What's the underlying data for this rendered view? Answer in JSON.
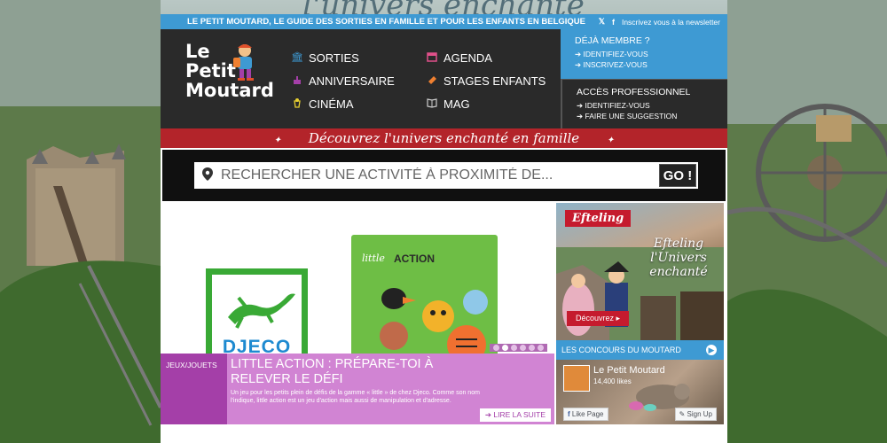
{
  "background": {
    "title": "l'univers enchanté"
  },
  "topbar": {
    "tagline": "LE PETIT MOUTARD, LE GUIDE DES SORTIES EN FAMILLE ET POUR LES ENFANTS EN BELGIQUE",
    "twitter_icon": "twitter-icon",
    "facebook_icon": "facebook-icon",
    "newsletter": "Inscrivez vous à la newsletter"
  },
  "logo": {
    "line1": "Le",
    "line2": "Petit",
    "line3": "Moutard"
  },
  "nav": {
    "items": [
      {
        "label": "SORTIES",
        "icon": "museum-icon",
        "color": "#3e9ad3"
      },
      {
        "label": "AGENDA",
        "icon": "calendar-icon",
        "color": "#e0508a"
      },
      {
        "label": "ANNIVERSAIRE",
        "icon": "cake-icon",
        "color": "#a43fa8"
      },
      {
        "label": "STAGES ENFANTS",
        "icon": "ticket-icon",
        "color": "#f08030"
      },
      {
        "label": "CINÉMA",
        "icon": "popcorn-icon",
        "color": "#e8d030"
      },
      {
        "label": "MAG",
        "icon": "book-icon",
        "color": "#cccccc"
      }
    ]
  },
  "member": {
    "heading": "DÉJÀ MEMBRE ?",
    "login": "IDENTIFIEZ-VOUS",
    "register": "INSCRIVEZ-VOUS"
  },
  "pro": {
    "heading": "ACCÈS PROFESSIONNEL",
    "login": "IDENTIFIEZ-VOUS",
    "suggest": "FAIRE UNE SUGGESTION"
  },
  "banner": {
    "text": "Découvrez l'univers enchanté en famille"
  },
  "search": {
    "placeholder": "RECHERCHER UNE ACTIVITÉ À PROXIMITÉ DE...",
    "go": "GO !"
  },
  "feature": {
    "djeco": "DJECO",
    "box_title": "ACTION",
    "box_script": "little",
    "tag": "JEUX/JOUETS",
    "title": "LITTLE ACTION : PRÉPARE-TOI À RELEVER LE DÉFI",
    "text": "Un jeu pour les petits plein de défis de la gamme « little » de chez Djeco. Comme son nom l'indique, little action est un jeu d'action mais aussi de manipulation et d'adresse.",
    "read_more": "LIRE LA SUITE",
    "slides": 6,
    "active_slide": 1
  },
  "ad": {
    "brand": "Efteling",
    "script": "Efteling l'Univers enchanté",
    "cta": "Découvrez"
  },
  "contest": {
    "label": "LES CONCOURS DU MOUTARD"
  },
  "facebook": {
    "name": "Le Petit Moutard",
    "likes": "14,400 likes",
    "like_page": "Like Page",
    "sign_up": "Sign Up"
  },
  "colors": {
    "blue": "#3e9ad3",
    "red": "#b3242a",
    "purple": "#a43fa8",
    "lilac": "#d184d3",
    "dark": "#2a2a2a"
  }
}
